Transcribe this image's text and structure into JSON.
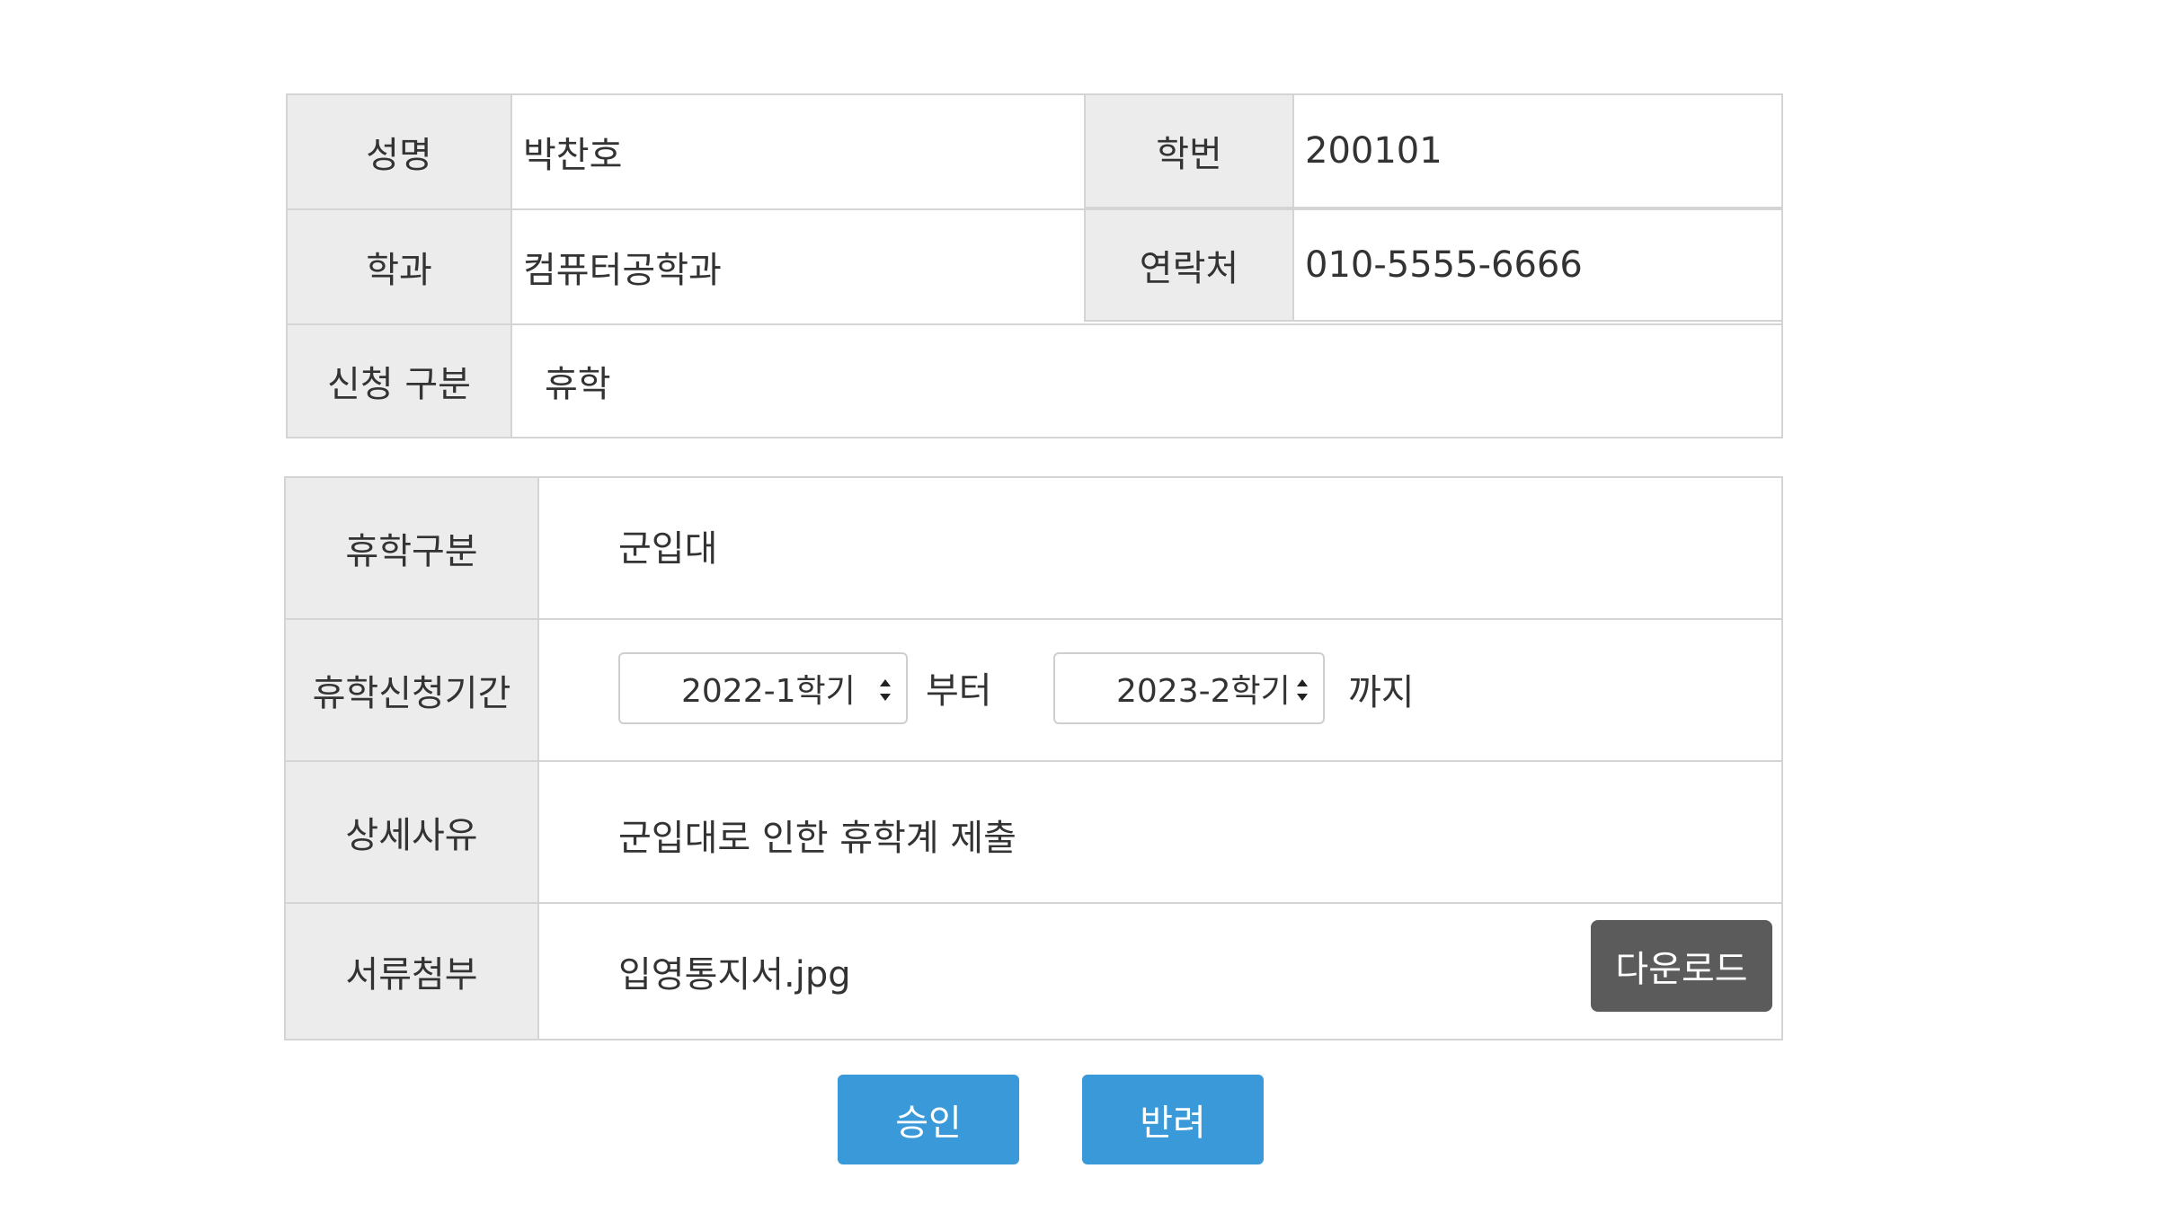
{
  "student": {
    "name_label": "성명",
    "name_value": "박찬호",
    "id_label": "학번",
    "id_value": "200101",
    "dept_label": "학과",
    "dept_value": "컴퓨터공학과",
    "phone_label": "연락처",
    "phone_value": "010-5555-6666",
    "type_label": "신청 구분",
    "type_value": "휴학"
  },
  "leave": {
    "category_label": "휴학구분",
    "category_value": "군입대",
    "period_label": "휴학신청기간",
    "period_from": "2022-1학기",
    "period_from_suffix": "부터",
    "period_to": "2023-2학기",
    "period_to_suffix": "까지",
    "reason_label": "상세사유",
    "reason_value": "군입대로 인한 휴학계 제출",
    "attachment_label": "서류첨부",
    "attachment_value": "입영통지서.jpg",
    "download_label": "다운로드"
  },
  "actions": {
    "approve_label": "승인",
    "reject_label": "반려"
  },
  "colors": {
    "label_bg": "#ececec",
    "border": "#d4d4d4",
    "primary_button": "#3a9ad9",
    "download_button": "#5b5b5b"
  },
  "icons": {
    "spinner": "updown-spinner-icon"
  }
}
